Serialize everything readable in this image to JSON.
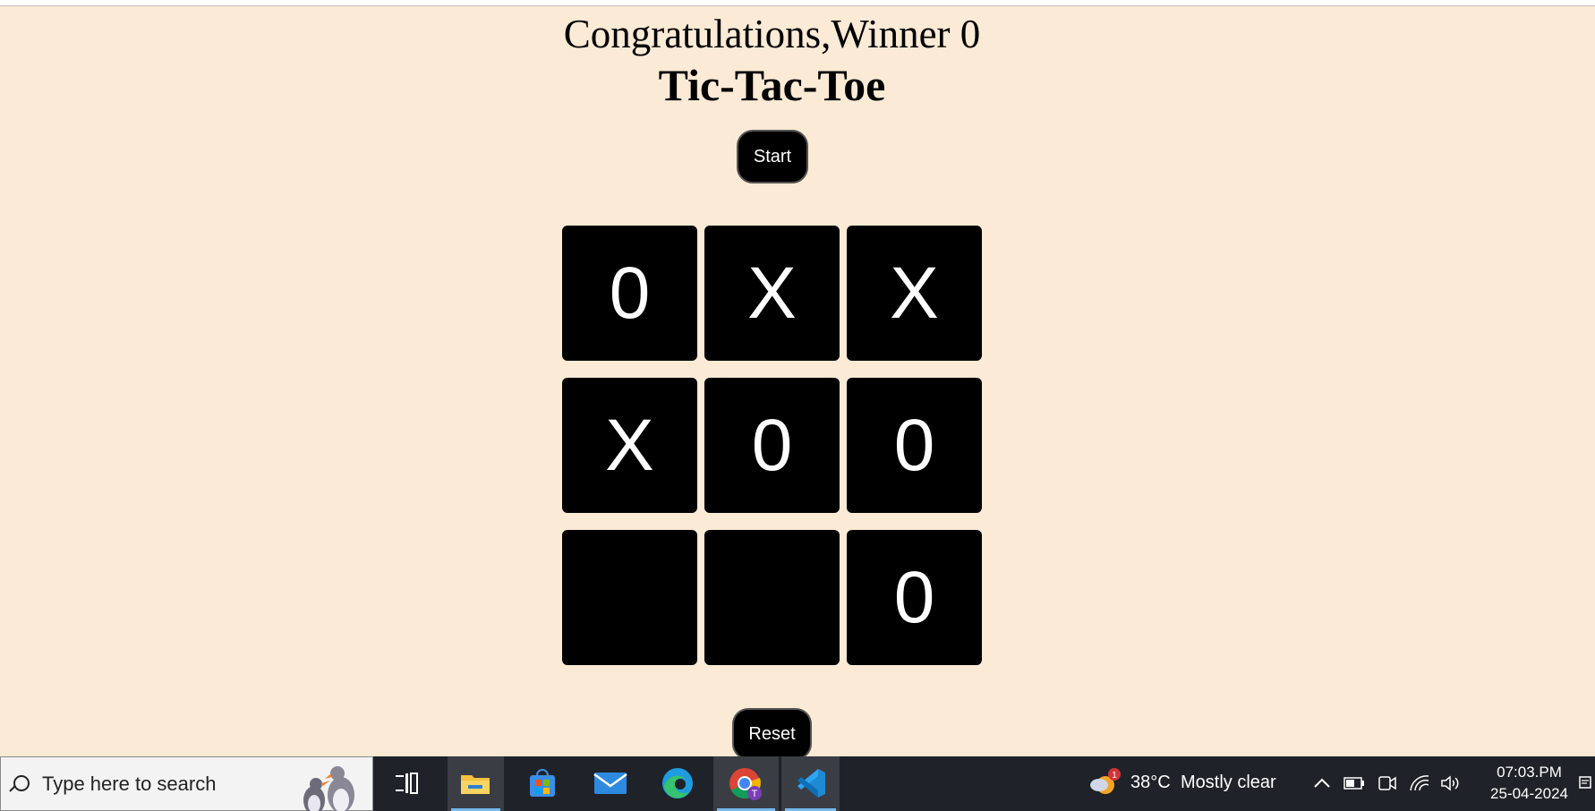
{
  "game": {
    "message": "Congratulations,Winner 0",
    "title": "Tic-Tac-Toe",
    "start_label": "Start",
    "reset_label": "Reset",
    "board": [
      "0",
      "X",
      "X",
      "X",
      "0",
      "0",
      "",
      "",
      "0"
    ]
  },
  "taskbar": {
    "search_placeholder": "Type here to search",
    "weather_badge": "1",
    "weather_temp": "38°C",
    "weather_desc": "Mostly clear",
    "time": "07:03.PM",
    "date": "25-04-2024",
    "apps": [
      "task-view-icon",
      "file-explorer-icon",
      "microsoft-store-icon",
      "mail-icon",
      "edge-icon",
      "chrome-icon",
      "vscode-icon"
    ]
  }
}
